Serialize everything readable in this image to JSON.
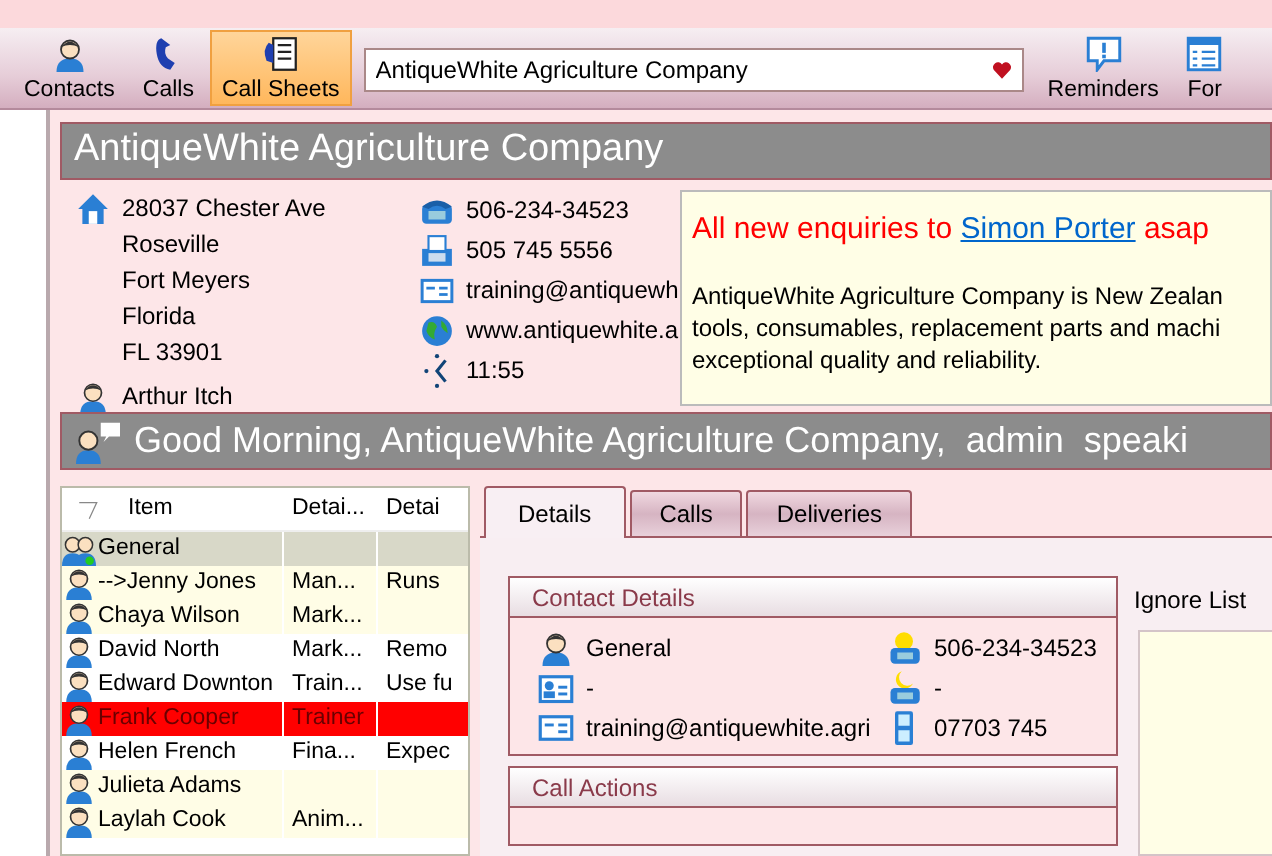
{
  "toolbar": {
    "buttons": [
      {
        "label": "Contacts",
        "selected": false
      },
      {
        "label": "Calls",
        "selected": false
      },
      {
        "label": "Call Sheets",
        "selected": true
      }
    ],
    "company_field": {
      "value": "AntiqueWhite Agriculture Company"
    },
    "right_buttons": [
      {
        "label": "Reminders"
      },
      {
        "label": "For"
      }
    ]
  },
  "company_header": "AntiqueWhite Agriculture Company",
  "address": {
    "lines": [
      "28037 Chester Ave",
      "Roseville",
      "Fort Meyers",
      "Florida",
      "FL 33901"
    ],
    "contact": "Arthur Itch"
  },
  "communications": [
    "506-234-34523",
    "505 745 5556",
    "training@antiquewh",
    "www.antiquewhite.a",
    "11:55"
  ],
  "note": {
    "headline_before": "All new enquiries to ",
    "headline_link": "Simon Porter",
    "headline_after": " asap",
    "lines": [
      "AntiqueWhite Agriculture Company is New Zealan",
      "tools, consumables, replacement parts and machi",
      "exceptional quality and reliability."
    ]
  },
  "greeting": "Good Morning, AntiqueWhite Agriculture Company,  admin  speaki",
  "contact_list": {
    "columns": [
      "Item",
      "Detai...",
      "Detai"
    ],
    "rows": [
      {
        "kind": "group",
        "color": "#d8d8c8",
        "cells": [
          "General",
          "",
          ""
        ]
      },
      {
        "kind": "contact",
        "color": "#fffde6",
        "cells": [
          "-->Jenny Jones",
          "Man...",
          "Runs"
        ]
      },
      {
        "kind": "contact",
        "color": "#fffde6",
        "cells": [
          "Chaya Wilson",
          "Mark...",
          ""
        ]
      },
      {
        "kind": "contact",
        "color": "#ffffff",
        "cells": [
          "David North",
          "Mark...",
          "Remo"
        ]
      },
      {
        "kind": "contact",
        "color": "#ffffff",
        "cells": [
          "Edward Downton",
          "Train...",
          "Use fu"
        ]
      },
      {
        "kind": "contact",
        "color": "#ff0000",
        "cells": [
          "Frank Cooper",
          "Trainer",
          ""
        ]
      },
      {
        "kind": "contact",
        "color": "#ffffff",
        "cells": [
          "Helen French",
          "Fina...",
          "Expec"
        ]
      },
      {
        "kind": "contact",
        "color": "#fffde6",
        "cells": [
          "Julieta Adams",
          "",
          ""
        ]
      },
      {
        "kind": "contact",
        "color": "#fffde6",
        "cells": [
          "Laylah Cook",
          "Anim...",
          ""
        ]
      }
    ]
  },
  "tabs": [
    {
      "label": "Details",
      "selected": true
    },
    {
      "label": "Calls",
      "selected": false
    },
    {
      "label": "Deliveries",
      "selected": false
    }
  ],
  "contact_details": {
    "title": "Contact Details",
    "items": [
      {
        "kind": "person",
        "text": "General"
      },
      {
        "kind": "day-phone",
        "text": "506-234-34523"
      },
      {
        "kind": "id-card",
        "text": "-"
      },
      {
        "kind": "night-phone",
        "text": "-"
      },
      {
        "kind": "email",
        "text": "training@antiquewhite.agri"
      },
      {
        "kind": "mobile",
        "text": "07703 745"
      }
    ]
  },
  "call_actions": {
    "title": "Call Actions"
  },
  "ignore_list": {
    "label": "Ignore List"
  }
}
